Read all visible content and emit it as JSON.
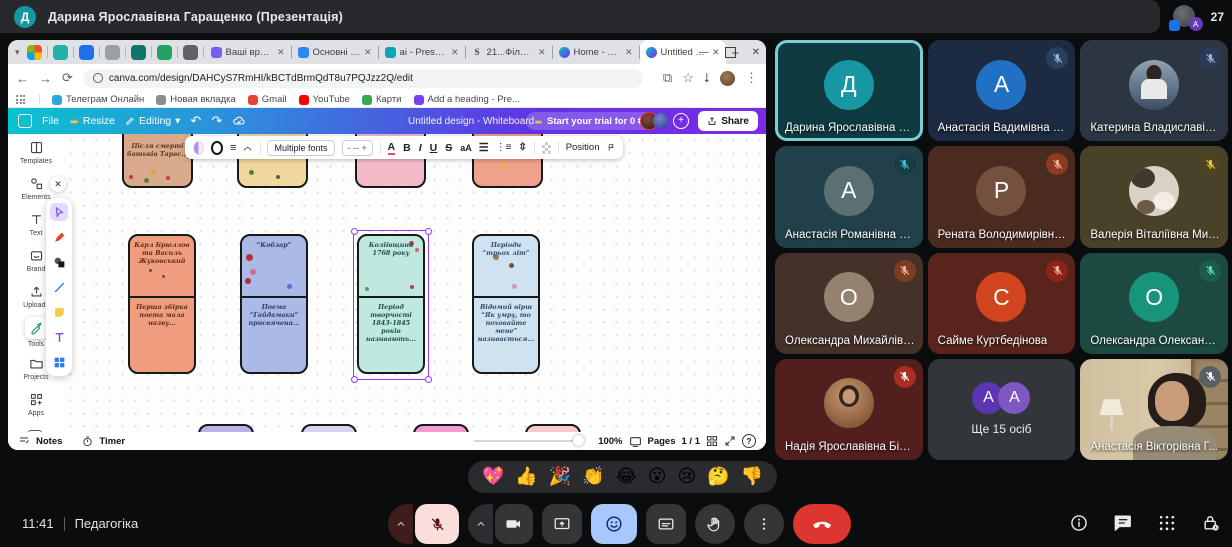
{
  "meet": {
    "top_bar": {
      "presenter_initial": "Д",
      "title": "Дарина Ярославівна Гаращенко (Презентація)",
      "stack_letter": "А",
      "participant_count": "27"
    },
    "participants": [
      {
        "name": "Дарина Ярославівна Га...",
        "type": "initial",
        "initial": "Д",
        "tile_bg": "#0e3a40",
        "avatar_bg": "#1896a3",
        "muted": false,
        "speaking": true
      },
      {
        "name": "Анастасія Вадимівна М...",
        "type": "initial",
        "initial": "А",
        "tile_bg": "#1c2b41",
        "avatar_bg": "#2070c4",
        "muted": true,
        "badge_bg": "#27405e",
        "badge_ic": "#9fb6d9"
      },
      {
        "name": "Катерина Владиславів...",
        "type": "photo",
        "photo": "g1",
        "tile_bg": "#2c3542",
        "muted": true,
        "badge_bg": "#2b3b55",
        "badge_ic": "#9fb6d9"
      },
      {
        "name": "Анастасія Романівна В...",
        "type": "initial",
        "initial": "А",
        "tile_bg": "#224049",
        "avatar_bg": "#5c6f75",
        "muted": true,
        "badge_bg": "#173c46",
        "badge_ic": "#35c7d6"
      },
      {
        "name": "Рената Володимирівна ...",
        "type": "initial",
        "initial": "Р",
        "tile_bg": "#4b2a20",
        "avatar_bg": "#74503f",
        "muted": true,
        "badge_bg": "#8c3a22",
        "badge_ic": "#f0b09e"
      },
      {
        "name": "Валерія Віталіївна Мир...",
        "type": "photo",
        "photo": "cat",
        "tile_bg": "#4a4228",
        "muted": true,
        "badge_bg": "#4f4420",
        "badge_ic": "#ecc93f"
      },
      {
        "name": "Олександра Михайлівн...",
        "type": "initial",
        "initial": "О",
        "tile_bg": "#463128",
        "avatar_bg": "#94816f",
        "muted": true,
        "badge_bg": "#7c3c20",
        "badge_ic": "#f0b09e"
      },
      {
        "name": "Сайме Куртбедінова",
        "type": "initial",
        "initial": "С",
        "tile_bg": "#58241b",
        "avatar_bg": "#d0451d",
        "muted": true,
        "badge_bg": "#8c2418",
        "badge_ic": "#f3b0a6"
      },
      {
        "name": "Олександра Олександ...",
        "type": "initial",
        "initial": "О",
        "tile_bg": "#1c4a41",
        "avatar_bg": "#17947a",
        "muted": true,
        "badge_bg": "#1d5c4c",
        "badge_ic": "#4fe3b0"
      },
      {
        "name": "Надія Ярославівна Білик",
        "type": "photo",
        "photo": "g2",
        "tile_bg": "#521f1e",
        "muted": true,
        "badge_bg": "#aa2d24",
        "badge_ic": "#ffffff"
      },
      {
        "name": "Ще 15 осіб",
        "type": "overflow",
        "initial": "А",
        "tile_bg": "#32353a",
        "circle_colors": [
          "#5b35b2",
          "#7e57c2"
        ],
        "muted": false
      },
      {
        "name": "Анастасія Вікторівна Г...",
        "type": "video",
        "tile_bg": "#8a7c60",
        "muted": true,
        "badge_bg": "#5a5f63",
        "badge_ic": "#ffffff"
      }
    ],
    "reactions": [
      "💖",
      "👍",
      "🎉",
      "👏",
      "😂",
      "😮",
      "😢",
      "🤔",
      "👎"
    ],
    "footer": {
      "time": "11:41",
      "meeting_name": "Педагогіка"
    },
    "controls": [
      {
        "name": "microphone-muted",
        "icon": "micoff",
        "variant": "mic"
      },
      {
        "name": "camera",
        "icon": "camera",
        "variant": "cam"
      },
      {
        "name": "present-screen",
        "icon": "present",
        "variant": "dark"
      },
      {
        "name": "reactions",
        "icon": "smiley",
        "variant": "active"
      },
      {
        "name": "captions",
        "icon": "cc",
        "variant": "dark"
      },
      {
        "name": "raise-hand",
        "icon": "hand",
        "variant": "circle"
      },
      {
        "name": "more-options",
        "icon": "dots",
        "variant": "circle"
      },
      {
        "name": "end-call",
        "icon": "phonedown",
        "variant": "end"
      }
    ],
    "right_icons": [
      {
        "name": "meeting-details",
        "icon": "info"
      },
      {
        "name": "chat",
        "icon": "chat"
      },
      {
        "name": "activities",
        "icon": "grid9"
      },
      {
        "name": "host-controls",
        "icon": "lock"
      }
    ]
  },
  "browser": {
    "pinned_tabs": [
      "#multi",
      "#20b2aa",
      "#1f6feb",
      "#9aa0a6",
      "#0f766e",
      "#21a366",
      "#5f6368"
    ],
    "tabs": [
      {
        "label": "Ваші враження",
        "favicon": "#7b5cf0",
        "active": false
      },
      {
        "label": "Основні ідеї Го...",
        "favicon": "#3086f6",
        "active": false
      },
      {
        "label": "аі - Presentation",
        "favicon": "#0ea5b5",
        "active": false
      },
      {
        "label": "21...Філософія з..",
        "favicon": "S",
        "active": false
      },
      {
        "label": "Home - Canva",
        "favicon": "canva",
        "active": false
      },
      {
        "label": "Untitled design",
        "favicon": "canva",
        "active": true
      }
    ],
    "url": "canva.com/design/DAHCyS7RmHI/kBCTdBrmQdT8u7PQJzz2Q/edit",
    "bookmarks": [
      {
        "label": "Телеграм Онлайн",
        "color": "#2aa7de"
      },
      {
        "label": "Новая вкладка",
        "color": "#8a8f94"
      },
      {
        "label": "Gmail",
        "color": "#ea4335"
      },
      {
        "label": "YouTube",
        "color": "#ff0000"
      },
      {
        "label": "Карти",
        "color": "#34a853"
      },
      {
        "label": "Add a heading - Pre...",
        "color": "#7b3ff2"
      }
    ]
  },
  "canva": {
    "toolbar": {
      "file": "File",
      "resize": "Resize",
      "editing": "Editing",
      "doc_title": "Untitled design - Whiteboard",
      "trial_label": "Start your trial for 0 ₴",
      "share_label": "Share"
    },
    "text_toolbar": {
      "font_label": "Multiple fonts",
      "size_label": "-  --  +",
      "format_buttons": [
        "A",
        "B",
        "I",
        "U",
        "S",
        "aA"
      ],
      "position_label": "Position"
    },
    "sidebar": [
      {
        "label": "Templates",
        "icon": "templates"
      },
      {
        "label": "Elements",
        "icon": "elements"
      },
      {
        "label": "Text",
        "icon": "text"
      },
      {
        "label": "Brand",
        "icon": "brand",
        "crown": true
      },
      {
        "label": "Uploads",
        "icon": "uploads"
      },
      {
        "label": "Tools",
        "icon": "tools",
        "selected": true
      },
      {
        "label": "Projects",
        "icon": "projects"
      },
      {
        "label": "Apps",
        "icon": "apps"
      }
    ],
    "tools_panel": [
      "select",
      "marker",
      "shapes",
      "line",
      "sticky",
      "texttool",
      "table"
    ],
    "canvas_cards": {
      "top_row": [
        {
          "bg": "#d8a98b",
          "ink": "#5a3320",
          "text": "Після смерті батьків Тарас...",
          "decor": "flowers"
        },
        {
          "bg": "#f0d79e",
          "ink": "#6a5420",
          "text": "",
          "decor": "leaves"
        },
        {
          "bg": "#f3bac7",
          "ink": "#5a2c3a",
          "text": "",
          "decor": "cap"
        },
        {
          "bg": "#efa18b",
          "ink": "#5d2c18",
          "text": "",
          "decor": "coins"
        }
      ],
      "middle_row": [
        {
          "bg": "#ef9d7e",
          "ink": "#5d2c18",
          "top": "Карл Брюллов та Василь Жуковський",
          "bottom": "Перша збірка поета мала назву...",
          "decor": "sketch",
          "selected": false
        },
        {
          "bg": "#aab9e6",
          "ink": "#2d3a66",
          "top": "“Кобзар”",
          "bottom": "Поема “Гайдамаки” присвячена...",
          "decor": "roses",
          "selected": false
        },
        {
          "bg": "#bfe9e0",
          "ink": "#1d4f4a",
          "top": "Коліївщина 1768 року",
          "bottom": "Період творчості 1843-1845 років називають...",
          "decor": "vine",
          "selected": true
        },
        {
          "bg": "#cfe2f0",
          "ink": "#2f4a66",
          "top": "Періоди “трьох літ”",
          "bottom": "Відомий вірш “Як умру, то поховайте мене” називається...",
          "decor": "bird",
          "selected": false
        }
      ],
      "bottom_row_colors": [
        "#b9b1e8",
        "#d8d3f0",
        "#f09ad0",
        "#f7c9cf"
      ]
    },
    "status": {
      "notes": "Notes",
      "timer": "Timer",
      "zoom": "100%",
      "pages": "Pages",
      "page_num": "1 / 1"
    }
  }
}
